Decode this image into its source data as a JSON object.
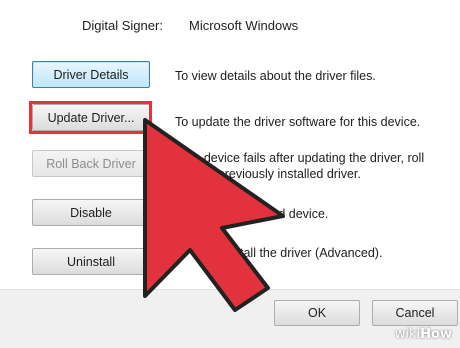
{
  "header": {
    "signer_label": "Digital Signer:",
    "signer_value": "Microsoft Windows"
  },
  "buttons": {
    "driver_details": "Driver Details",
    "update_driver": "Update Driver...",
    "roll_back": "Roll Back Driver",
    "disable": "Disable",
    "uninstall": "Uninstall",
    "ok": "OK",
    "cancel": "Cancel"
  },
  "descriptions": {
    "driver_details": "To view details about the driver files.",
    "update_driver": "To update the driver software for this device.",
    "roll_back_line1": "the device fails after updating the driver, roll",
    "roll_back_line2": "to the previously installed driver.",
    "disable": "elected device.",
    "uninstall": "tall the driver (Advanced)."
  },
  "overlay": {
    "arrow_color": "#e2323d",
    "highlight_color": "#e6323c",
    "watermark_wiki": "wiki",
    "watermark_how": "How"
  }
}
